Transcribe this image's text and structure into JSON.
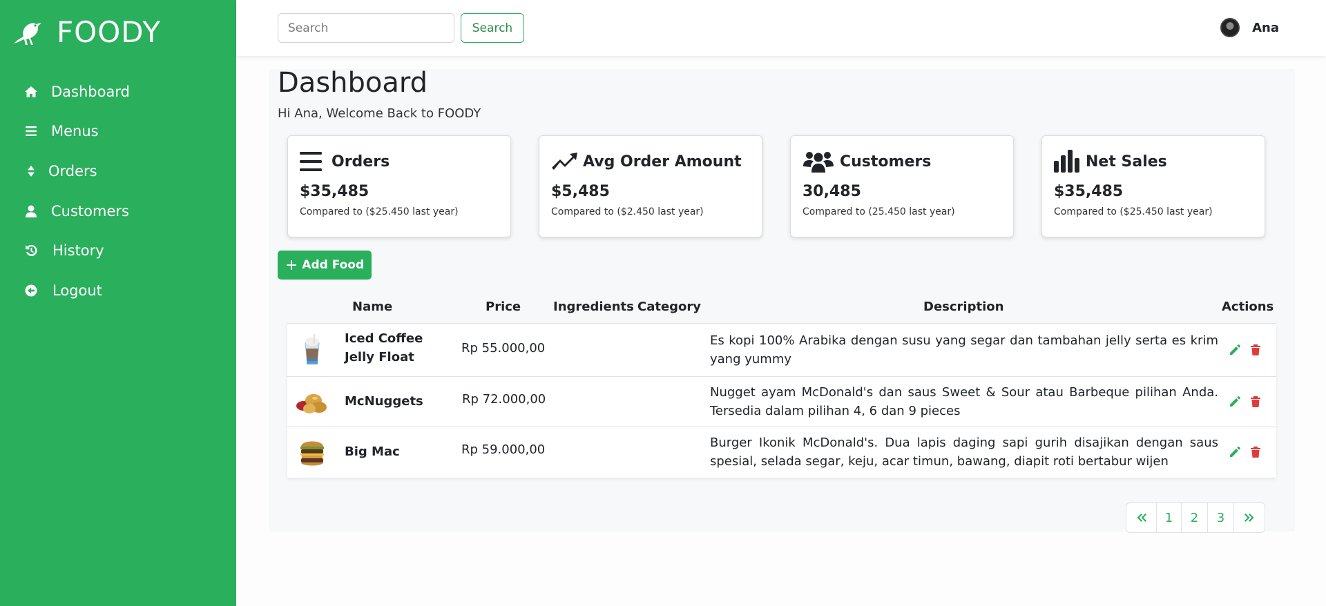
{
  "brand": {
    "name": "FOODY"
  },
  "sidebar": {
    "items": [
      {
        "label": "Dashboard",
        "icon": "home-icon"
      },
      {
        "label": "Menus",
        "icon": "bars-icon"
      },
      {
        "label": "Orders",
        "icon": "sort-icon"
      },
      {
        "label": "Customers",
        "icon": "user-icon"
      },
      {
        "label": "History",
        "icon": "history-icon"
      },
      {
        "label": "Logout",
        "icon": "arrow-circle-left-icon"
      }
    ]
  },
  "header": {
    "search_placeholder": "Search",
    "search_button": "Search",
    "user_name": "Ana"
  },
  "main": {
    "title": "Dashboard",
    "welcome": "Hi Ana, Welcome Back to FOODY",
    "cards": [
      {
        "title": "Orders",
        "value": "$35,485",
        "sub": "Compared to ($25.450 last year)",
        "icon": "bars-icon"
      },
      {
        "title": "Avg Order Amount",
        "value": "$5,485",
        "sub": "Compared to ($2.450 last year)",
        "icon": "trend-up-icon"
      },
      {
        "title": "Customers",
        "value": "30,485",
        "sub": "Compared to (25.450 last year)",
        "icon": "users-icon"
      },
      {
        "title": "Net Sales",
        "value": "$35,485",
        "sub": "Compared to ($25.450 last year)",
        "icon": "bar-chart-icon"
      }
    ],
    "add_button": "Add Food",
    "table": {
      "headers": {
        "name": "Name",
        "price": "Price",
        "ingredients": "Ingredients",
        "category": "Category",
        "description": "Description",
        "actions": "Actions"
      },
      "rows": [
        {
          "name": "Iced Coffee Jelly Float",
          "price": "Rp 55.000,00",
          "ingredients": "",
          "category": "",
          "description": "Es kopi 100% Arabika dengan susu yang segar dan tambahan jelly serta es krim yang yummy",
          "image": "iced-coffee-image"
        },
        {
          "name": "McNuggets",
          "price": "Rp 72.000,00",
          "ingredients": "",
          "category": "",
          "description": "Nugget ayam McDonald's dan saus Sweet & Sour atau Barbeque pilihan Anda. Tersedia dalam pilihan 4, 6 dan 9 pieces",
          "image": "nuggets-image"
        },
        {
          "name": "Big Mac",
          "price": "Rp 59.000,00",
          "ingredients": "",
          "category": "",
          "description": "Burger Ikonik McDonald's. Dua lapis daging sapi gurih disajikan dengan saus spesial, selada segar, keju, acar timun, bawang, diapit roti bertabur wijen",
          "image": "burger-image"
        }
      ]
    },
    "pagination": {
      "pages": [
        "1",
        "2",
        "3"
      ],
      "first_icon": "double-chevron-left-icon",
      "last_icon": "double-chevron-right-icon"
    }
  },
  "colors": {
    "accent": "#2aaf5c",
    "edit": "#2aaf5c",
    "delete": "#e03b3b"
  }
}
